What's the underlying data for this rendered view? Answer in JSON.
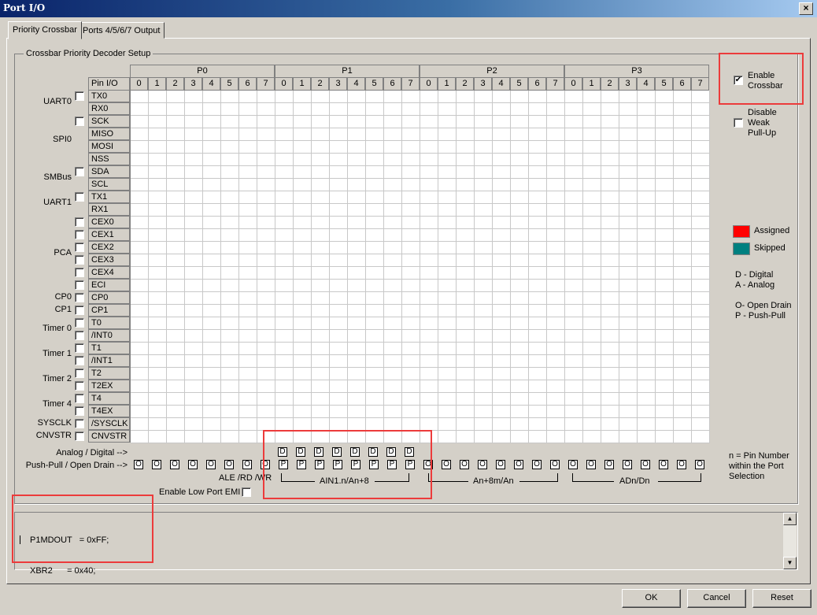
{
  "window": {
    "title": "Port I/O",
    "close_glyph": "×"
  },
  "tabs": [
    {
      "label": "Priority Crossbar",
      "selected": true
    },
    {
      "label": "Ports 4/5/6/7 Output",
      "selected": false
    }
  ],
  "group_caption": "Crossbar Priority Decoder Setup",
  "ports": [
    "P0",
    "P1",
    "P2",
    "P3"
  ],
  "pin_io_header": "Pin I/O",
  "bits": [
    "0",
    "1",
    "2",
    "3",
    "4",
    "5",
    "6",
    "7"
  ],
  "rows": [
    {
      "pin": "TX0"
    },
    {
      "pin": "RX0"
    },
    {
      "pin": "SCK"
    },
    {
      "pin": "MISO"
    },
    {
      "pin": "MOSI"
    },
    {
      "pin": "NSS"
    },
    {
      "pin": "SDA"
    },
    {
      "pin": "SCL"
    },
    {
      "pin": "TX1"
    },
    {
      "pin": "RX1"
    },
    {
      "pin": "CEX0"
    },
    {
      "pin": "CEX1"
    },
    {
      "pin": "CEX2"
    },
    {
      "pin": "CEX3"
    },
    {
      "pin": "CEX4"
    },
    {
      "pin": "ECI"
    },
    {
      "pin": "CP0"
    },
    {
      "pin": "CP1"
    },
    {
      "pin": "T0"
    },
    {
      "pin": "/INT0"
    },
    {
      "pin": "T1"
    },
    {
      "pin": "/INT1"
    },
    {
      "pin": "T2"
    },
    {
      "pin": "T2EX"
    },
    {
      "pin": "T4"
    },
    {
      "pin": "T4EX"
    },
    {
      "pin": "/SYSCLK"
    },
    {
      "pin": "CNVSTR"
    }
  ],
  "groups": [
    {
      "label": "UART0",
      "row": 0,
      "span": 2
    },
    {
      "label": "SPI0",
      "row": 2,
      "span": 4
    },
    {
      "label": "SMBus",
      "row": 6,
      "span": 2
    },
    {
      "label": "UART1",
      "row": 8,
      "span": 2
    },
    {
      "label": "PCA",
      "row": 10,
      "span": 6
    },
    {
      "label": "CP0",
      "row": 16,
      "span": 1
    },
    {
      "label": "CP1",
      "row": 17,
      "span": 1
    },
    {
      "label": "Timer 0",
      "row": 18,
      "span": 2
    },
    {
      "label": "Timer 1",
      "row": 20,
      "span": 2
    },
    {
      "label": "Timer 2",
      "row": 22,
      "span": 2
    },
    {
      "label": "Timer 4",
      "row": 24,
      "span": 2
    },
    {
      "label": "SYSCLK",
      "row": 26,
      "span": 1
    },
    {
      "label": "CNVSTR",
      "row": 27,
      "span": 1
    }
  ],
  "row_checkbox_rows": [
    0,
    2,
    6,
    8,
    10,
    11,
    12,
    13,
    14,
    15,
    16,
    17,
    18,
    19,
    20,
    21,
    22,
    23,
    24,
    25,
    26,
    27
  ],
  "options": {
    "enable_crossbar": {
      "label_line1": "Enable",
      "label_line2": "Crossbar",
      "checked": true,
      "check_glyph": "✔"
    },
    "disable_weak_pullup": {
      "label_line1": "Disable",
      "label_line2": "Weak",
      "label_line3": "Pull-Up",
      "checked": false
    }
  },
  "legend": {
    "assigned": {
      "label": "Assigned",
      "color": "#ff0000"
    },
    "skipped": {
      "label": "Skipped",
      "color": "#008080"
    },
    "digital": "D - Digital",
    "analog": "A - Analog",
    "open_drain": "O- Open Drain",
    "push_pull": "P - Push-Pull"
  },
  "port_modes": {
    "analog_digital_label": "Analog / Digital -->",
    "push_pull_label": "Push-Pull / Open Drain -->",
    "p1_digital": [
      "D",
      "D",
      "D",
      "D",
      "D",
      "D",
      "D",
      "D"
    ],
    "outputs": {
      "P0": [
        "O",
        "O",
        "O",
        "O",
        "O",
        "O",
        "O",
        "O"
      ],
      "P1": [
        "P",
        "P",
        "P",
        "P",
        "P",
        "P",
        "P",
        "P"
      ],
      "P2": [
        "O",
        "O",
        "O",
        "O",
        "O",
        "O",
        "O",
        "O"
      ],
      "P3": [
        "O",
        "O",
        "O",
        "O",
        "O",
        "O",
        "O",
        "O"
      ]
    },
    "ale_label": "ALE /RD /WR",
    "p1_note": "AIN1.n/An+8",
    "p2_note": "An+8m/An",
    "p3_note": "ADn/Dn",
    "pin_number_note_line1": "n = Pin Number",
    "pin_number_note_line2": "within the Port",
    "pin_number_note_line3": "Selection",
    "low_port_emi_label": "Enable Low Port EMI",
    "low_port_emi_checked": false
  },
  "code": {
    "line1": "P1MDOUT   = 0xFF;",
    "line2": "XBR2      = 0x40;"
  },
  "scroll_up_glyph": "▲",
  "scroll_down_glyph": "▼",
  "buttons": {
    "ok": "OK",
    "cancel": "Cancel",
    "reset": "Reset"
  },
  "highlight_color": "#ec3b3b"
}
